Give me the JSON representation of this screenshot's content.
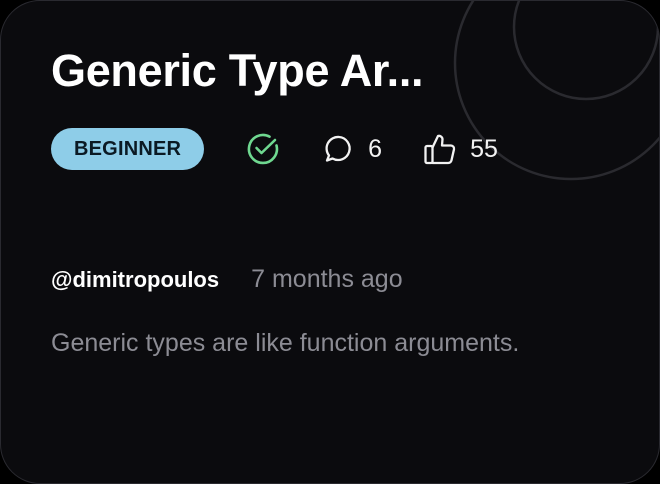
{
  "card": {
    "title": "Generic Type Ar...",
    "difficulty": "BEGINNER",
    "completed": true,
    "comments": "6",
    "likes": "55",
    "author": "@dimitropoulos",
    "time": "7 months ago",
    "description": "Generic types are like function arguments."
  },
  "colors": {
    "background": "#0b0b0e",
    "badge_bg": "#8ecde8",
    "check": "#6fd890",
    "muted_text": "#8c8c94"
  },
  "icons": {
    "check": "check-circle-icon",
    "comment": "comment-icon",
    "like": "thumbs-up-icon"
  }
}
